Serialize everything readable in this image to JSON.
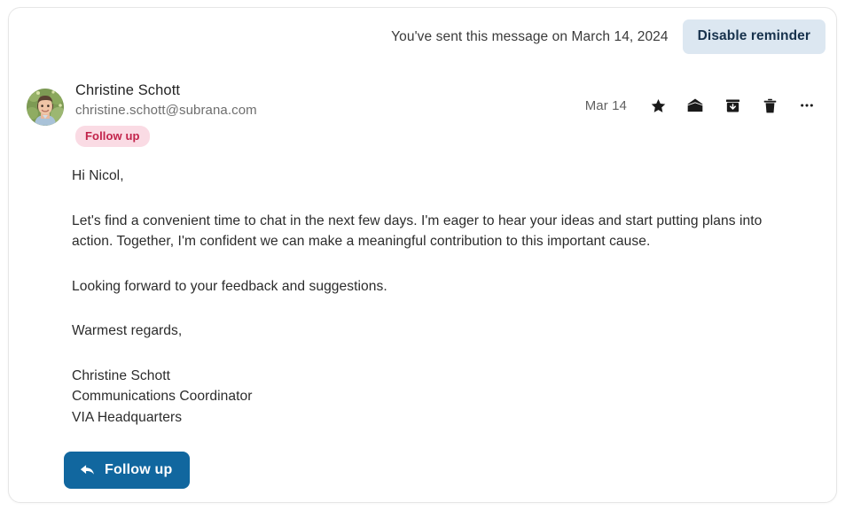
{
  "reminder": {
    "text": "You've sent this message on March 14, 2024",
    "disable_button": "Disable reminder"
  },
  "sender": {
    "name": "Christine Schott",
    "email": "christine.schott@subrana.com",
    "badge": "Follow up",
    "avatar_icon": "avatar-photo"
  },
  "header_actions": {
    "date": "Mar 14",
    "icons": [
      {
        "name": "star-icon",
        "label": "Flag"
      },
      {
        "name": "open-envelope-icon",
        "label": "Mark as unread"
      },
      {
        "name": "archive-icon",
        "label": "Archive"
      },
      {
        "name": "trash-icon",
        "label": "Delete"
      },
      {
        "name": "more-options-icon",
        "label": "More options"
      }
    ]
  },
  "body": {
    "greeting": "Hi Nicol,",
    "paragraph_1": "Let's find a convenient time to chat in the next few days. I'm eager to hear your ideas and start putting plans into action. Together, I'm confident we can make a meaningful contribution to this important cause.",
    "paragraph_2": "Looking forward to your feedback and suggestions.",
    "closing": "Warmest regards,",
    "signature_name": "Christine Schott",
    "signature_title": "Communications Coordinator",
    "signature_org": "VIA Headquarters"
  },
  "footer": {
    "followup_button": "Follow up",
    "followup_icon": "reply-arrow-icon"
  },
  "colors": {
    "accent_blue": "#11679f",
    "badge_pink_bg": "#fadbe4",
    "badge_pink_text": "#c2234a",
    "reminder_button_bg": "#dce7f1",
    "reminder_button_text": "#17324d",
    "card_border": "#e6e6e6"
  }
}
